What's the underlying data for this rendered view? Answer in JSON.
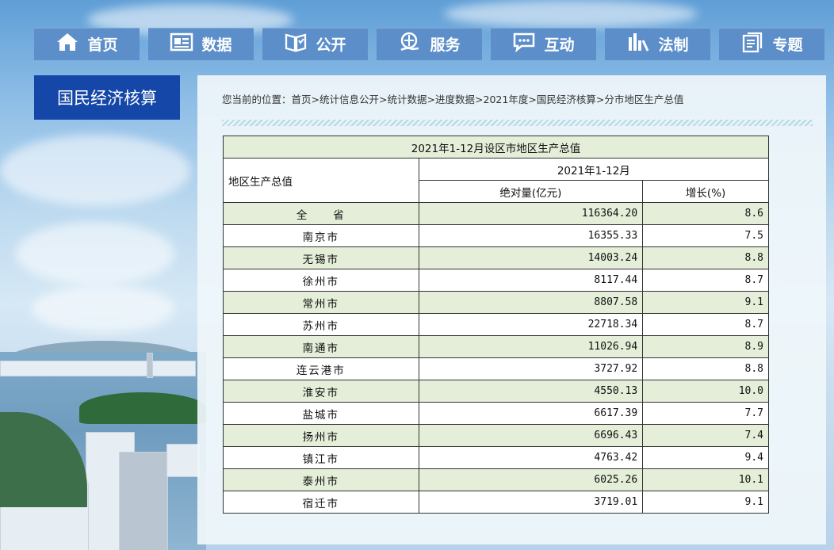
{
  "nav": [
    {
      "label": "首页",
      "icon": "home-icon"
    },
    {
      "label": "数据",
      "icon": "data-icon"
    },
    {
      "label": "公开",
      "icon": "book-icon"
    },
    {
      "label": "服务",
      "icon": "service-icon"
    },
    {
      "label": "互动",
      "icon": "chat-icon"
    },
    {
      "label": "法制",
      "icon": "law-icon"
    },
    {
      "label": "专题",
      "icon": "topic-icon"
    }
  ],
  "side_title": "国民经济核算",
  "breadcrumb": {
    "prefix": "您当前的位置：",
    "items": [
      "首页",
      "统计信息公开",
      "统计数据",
      "进度数据",
      "2021年度",
      "国民经济核算",
      "分市地区生产总值"
    ],
    "separator": ">"
  },
  "table": {
    "caption": "2021年1-12月设区市地区生产总值",
    "row_header": "地区生产总值",
    "period": "2021年1-12月",
    "col_value": "绝对量(亿元)",
    "col_growth": "增长(%)",
    "rows": [
      {
        "name": "全　　省",
        "value": "116364.20",
        "growth": "8.6"
      },
      {
        "name": "南京市",
        "value": "16355.33",
        "growth": "7.5"
      },
      {
        "name": "无锡市",
        "value": "14003.24",
        "growth": "8.8"
      },
      {
        "name": "徐州市",
        "value": "8117.44",
        "growth": "8.7"
      },
      {
        "name": "常州市",
        "value": "8807.58",
        "growth": "9.1"
      },
      {
        "name": "苏州市",
        "value": "22718.34",
        "growth": "8.7"
      },
      {
        "name": "南通市",
        "value": "11026.94",
        "growth": "8.9"
      },
      {
        "name": "连云港市",
        "value": "3727.92",
        "growth": "8.8"
      },
      {
        "name": "淮安市",
        "value": "4550.13",
        "growth": "10.0"
      },
      {
        "name": "盐城市",
        "value": "6617.39",
        "growth": "7.7"
      },
      {
        "name": "扬州市",
        "value": "6696.43",
        "growth": "7.4"
      },
      {
        "name": "镇江市",
        "value": "4763.42",
        "growth": "9.4"
      },
      {
        "name": "泰州市",
        "value": "6025.26",
        "growth": "10.1"
      },
      {
        "name": "宿迁市",
        "value": "3719.01",
        "growth": "9.1"
      }
    ]
  }
}
